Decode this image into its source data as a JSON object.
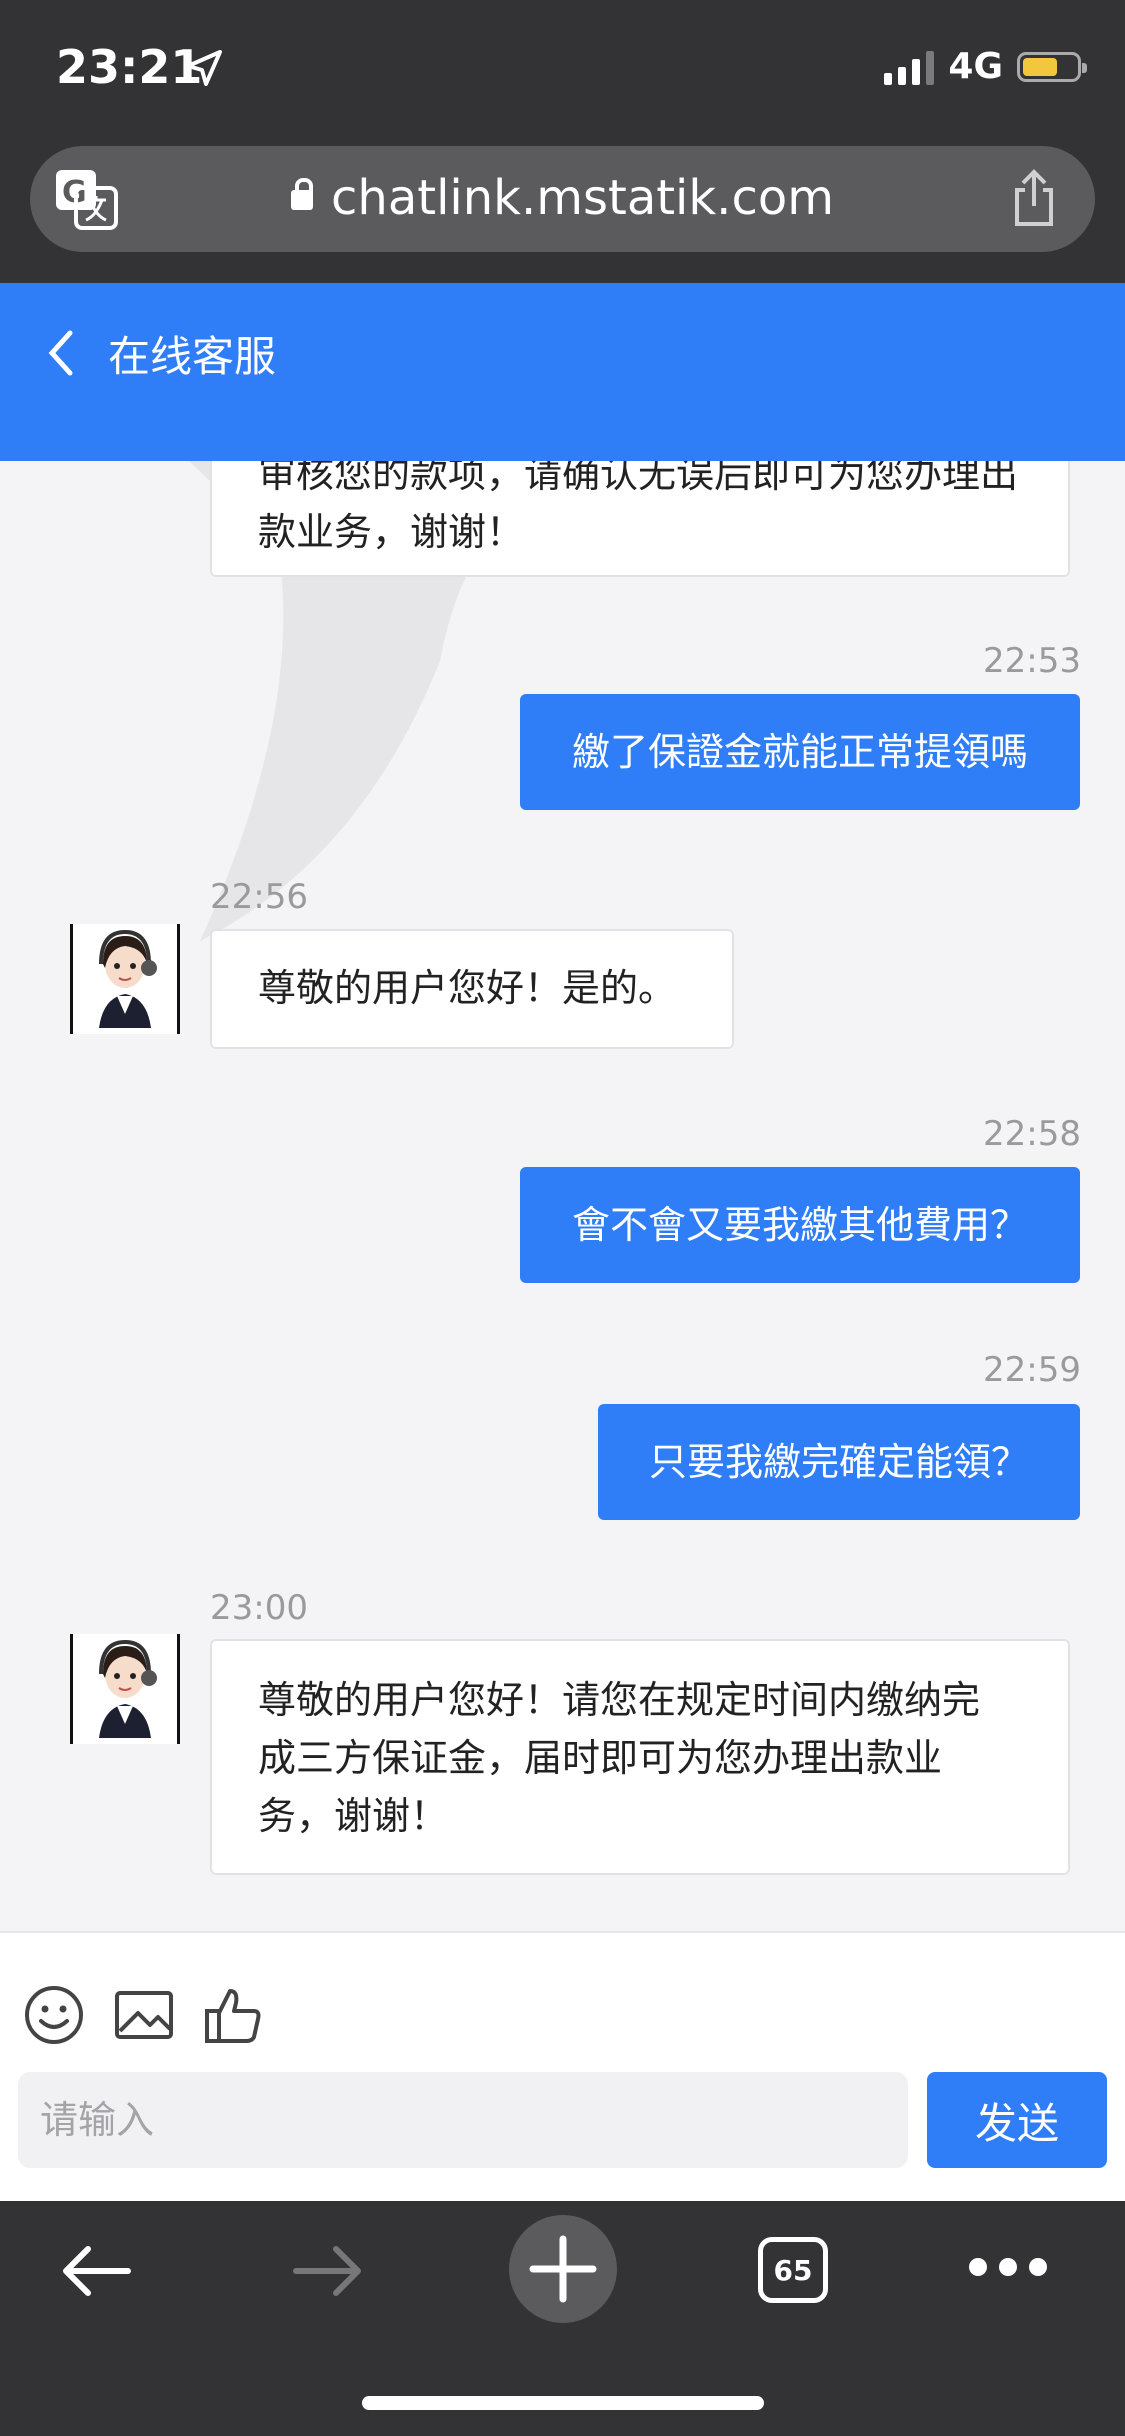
{
  "status_bar": {
    "time": "23:21",
    "network": "4G"
  },
  "browser": {
    "url": "chatlink.mstatik.com",
    "tab_count": "65"
  },
  "header": {
    "title": "在线客服"
  },
  "messages": [
    {
      "from": "agent",
      "lines": [
        "审核您的款项，请确认无误后即可为您办理出",
        "款业务，谢谢！"
      ]
    },
    {
      "from": "user",
      "time": "22:53",
      "text": "繳了保證金就能正常提領嗎"
    },
    {
      "from": "agent",
      "time": "22:56",
      "lines": [
        "尊敬的用户您好！是的。"
      ]
    },
    {
      "from": "user",
      "time": "22:58",
      "text": "會不會又要我繳其他費用？"
    },
    {
      "from": "user",
      "time": "22:59",
      "text": "只要我繳完確定能領？"
    },
    {
      "from": "agent",
      "time": "23:00",
      "lines": [
        "尊敬的用户您好！请您在规定时间内缴纳完",
        "成三方保证金，届时即可为您办理出款业",
        "务，谢谢！"
      ]
    }
  ],
  "composer": {
    "placeholder": "请输入",
    "send_label": "发送"
  },
  "colors": {
    "accent": "#2f7ef7",
    "chrome": "#333335",
    "background": "#f4f4f6"
  }
}
